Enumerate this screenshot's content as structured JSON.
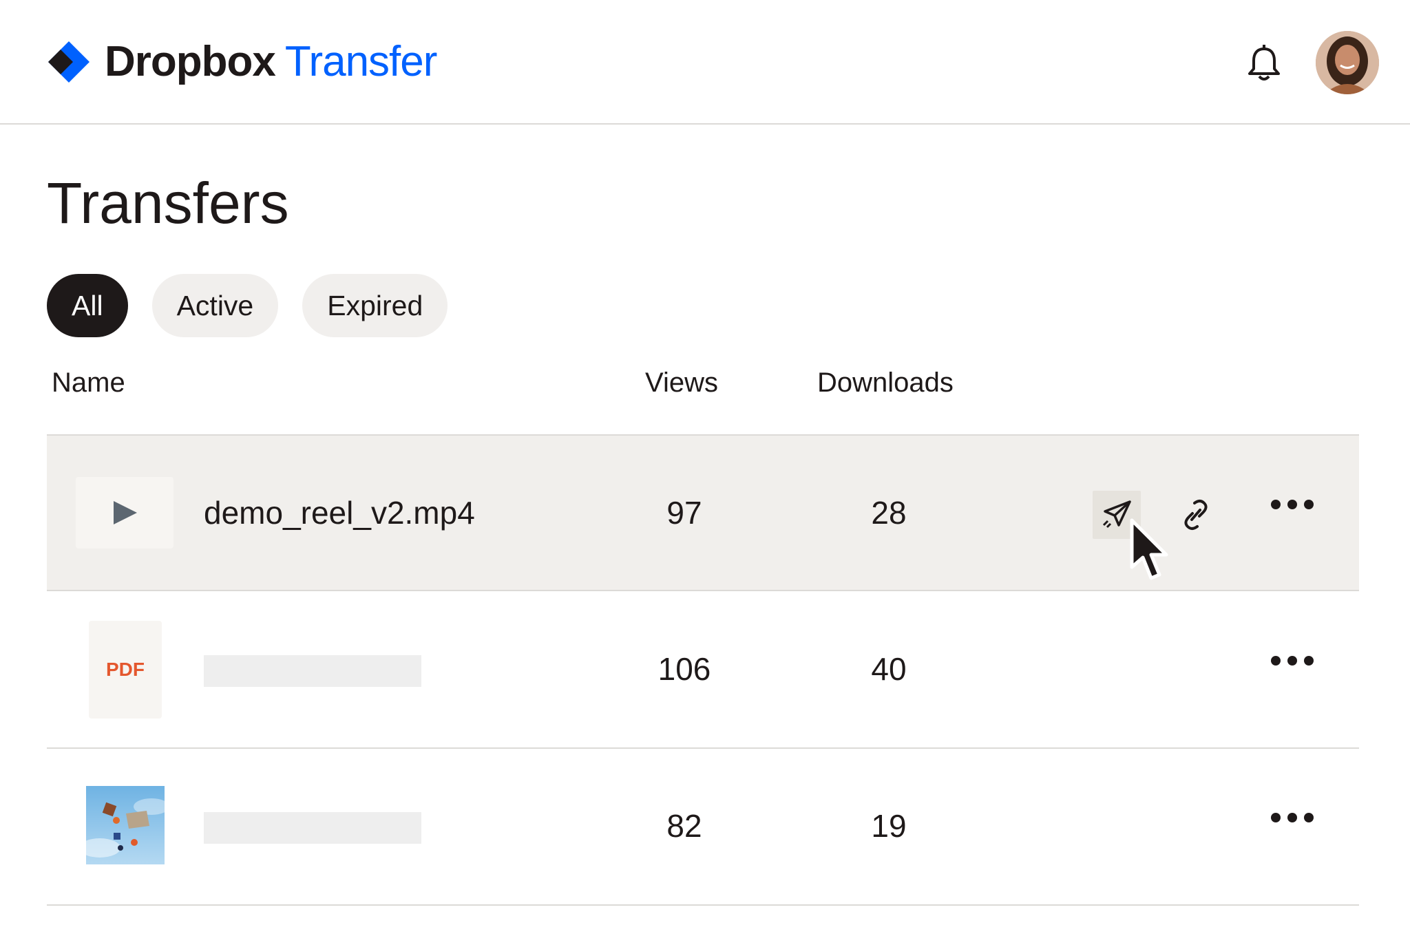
{
  "brand": {
    "name": "Dropbox",
    "product": "Transfer",
    "mark_color": "#0061fe",
    "accent": "#0061fe"
  },
  "header": {
    "icons": [
      "dropbox-logo-icon",
      "bell-icon",
      "avatar"
    ]
  },
  "page": {
    "title": "Transfers"
  },
  "filters": [
    {
      "label": "All",
      "selected": true
    },
    {
      "label": "Active",
      "selected": false
    },
    {
      "label": "Expired",
      "selected": false
    }
  ],
  "table": {
    "columns": {
      "name": "Name",
      "views": "Views",
      "downloads": "Downloads"
    },
    "rows": [
      {
        "type": "video",
        "name": "demo_reel_v2.mp4",
        "views": "97",
        "downloads": "28",
        "hovered": true,
        "actions": [
          "send-icon",
          "link-icon",
          "more-icon"
        ]
      },
      {
        "type": "pdf",
        "thumb_label": "PDF",
        "name": "",
        "views": "106",
        "downloads": "40",
        "actions": [
          "more-icon"
        ]
      },
      {
        "type": "image",
        "name": "",
        "views": "82",
        "downloads": "19",
        "actions": [
          "more-icon"
        ]
      }
    ]
  },
  "colors": {
    "hover_row": "#f1efec",
    "chip_bg": "#f1efed",
    "chip_active_bg": "#1e1919",
    "pdf_label": "#e4572e",
    "text": "#1e1919"
  }
}
